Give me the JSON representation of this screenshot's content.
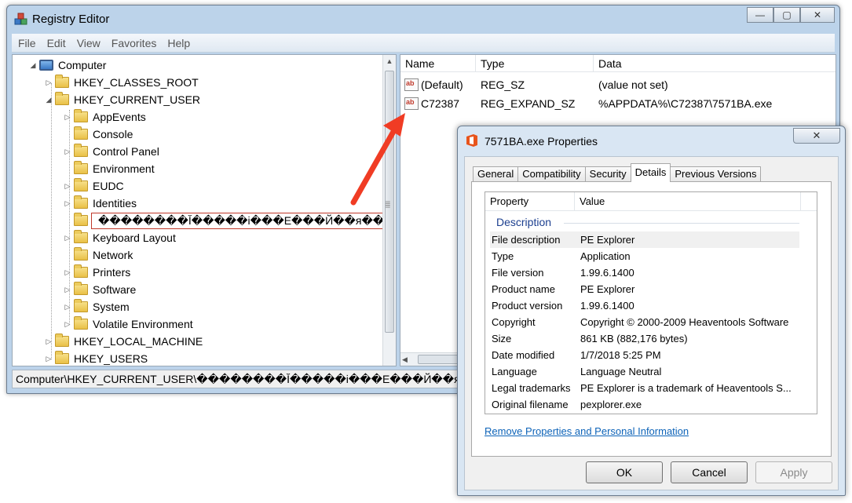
{
  "registry": {
    "title": "Registry Editor",
    "window_buttons": [
      "—",
      "▢",
      "✕"
    ],
    "menu": [
      "File",
      "Edit",
      "View",
      "Favorites",
      "Help"
    ],
    "tree": [
      {
        "label": "Computer",
        "level": 0,
        "expander": "◢",
        "icon": "computer-icon"
      },
      {
        "label": "HKEY_CLASSES_ROOT",
        "level": 1,
        "expander": "▷",
        "icon": "folder-icon"
      },
      {
        "label": "HKEY_CURRENT_USER",
        "level": 1,
        "expander": "◢",
        "icon": "folder-icon"
      },
      {
        "label": "AppEvents",
        "level": 2,
        "expander": "▷",
        "icon": "folder-icon"
      },
      {
        "label": "Console",
        "level": 2,
        "expander": "",
        "icon": "folder-icon"
      },
      {
        "label": "Control Panel",
        "level": 2,
        "expander": "▷",
        "icon": "folder-icon"
      },
      {
        "label": "Environment",
        "level": 2,
        "expander": "",
        "icon": "folder-icon"
      },
      {
        "label": "EUDC",
        "level": 2,
        "expander": "▷",
        "icon": "folder-icon"
      },
      {
        "label": "Identities",
        "level": 2,
        "expander": "▷",
        "icon": "folder-icon"
      },
      {
        "label": "��������Ĭ�����і���Е���Й��я��",
        "level": 2,
        "expander": "",
        "icon": "folder-icon",
        "selected": true
      },
      {
        "label": "Keyboard Layout",
        "level": 2,
        "expander": "▷",
        "icon": "folder-icon"
      },
      {
        "label": "Network",
        "level": 2,
        "expander": "",
        "icon": "folder-icon"
      },
      {
        "label": "Printers",
        "level": 2,
        "expander": "▷",
        "icon": "folder-icon"
      },
      {
        "label": "Software",
        "level": 2,
        "expander": "▷",
        "icon": "folder-icon"
      },
      {
        "label": "System",
        "level": 2,
        "expander": "▷",
        "icon": "folder-icon"
      },
      {
        "label": "Volatile Environment",
        "level": 2,
        "expander": "▷",
        "icon": "folder-icon"
      },
      {
        "label": "HKEY_LOCAL_MACHINE",
        "level": 1,
        "expander": "▷",
        "icon": "folder-icon"
      },
      {
        "label": "HKEY_USERS",
        "level": 1,
        "expander": "▷",
        "icon": "folder-icon"
      }
    ],
    "columns": [
      "Name",
      "Type",
      "Data"
    ],
    "values": [
      {
        "name": "(Default)",
        "type": "REG_SZ",
        "data": "(value not set)"
      },
      {
        "name": "C72387",
        "type": "REG_EXPAND_SZ",
        "data": "%APPDATA%\\C72387\\7571BA.exe"
      }
    ],
    "status_path": "Computer\\HKEY_CURRENT_USER\\��������Ĭ�����і���Е���Й��я��"
  },
  "annotation": {
    "arrow_color": "#f03c24"
  },
  "properties": {
    "title": "7571BA.exe Properties",
    "close_glyph": "✕",
    "tabs": [
      "General",
      "Compatibility",
      "Security",
      "Details",
      "Previous Versions"
    ],
    "active_tab": "Details",
    "list_headers": [
      "Property",
      "Value"
    ],
    "group_title": "Description",
    "rows": [
      {
        "prop": "File description",
        "val": "PE Explorer"
      },
      {
        "prop": "Type",
        "val": "Application"
      },
      {
        "prop": "File version",
        "val": "1.99.6.1400"
      },
      {
        "prop": "Product name",
        "val": "PE Explorer"
      },
      {
        "prop": "Product version",
        "val": "1.99.6.1400"
      },
      {
        "prop": "Copyright",
        "val": "Copyright © 2000-2009 Heaventools Software"
      },
      {
        "prop": "Size",
        "val": "861 KB (882,176 bytes)"
      },
      {
        "prop": "Date modified",
        "val": "1/7/2018 5:25 PM"
      },
      {
        "prop": "Language",
        "val": "Language Neutral"
      },
      {
        "prop": "Legal trademarks",
        "val": "PE Explorer is a trademark of Heaventools S..."
      },
      {
        "prop": "Original filename",
        "val": "pexplorer.exe"
      }
    ],
    "remove_link": "Remove Properties and Personal Information",
    "buttons": {
      "ok": "OK",
      "cancel": "Cancel",
      "apply": "Apply"
    }
  }
}
